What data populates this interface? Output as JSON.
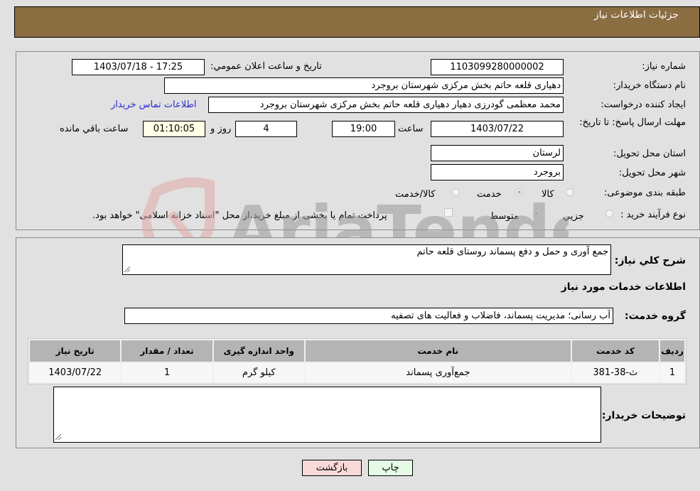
{
  "header": {
    "title": "جزئیات اطلاعات نیاز"
  },
  "form": {
    "need_number": {
      "label": "شماره نیاز:",
      "value": "1103099280000002"
    },
    "announce_datetime": {
      "label": "تاريخ و ساعت اعلان عمومي:",
      "value": "1403/07/18 - 17:25"
    },
    "buyer_org": {
      "label": "نام دستگاه خریدار:",
      "value": "دهیاری قلعه حاتم بخش مرکزی شهرستان بروجرد"
    },
    "requester": {
      "label": "ایجاد کننده درخواست:",
      "value": "محمد معظمی گودرزی دهیار دهیاری قلعه حاتم بخش مرکزی شهرستان بروجرد"
    },
    "buyer_contact_link": "اطلاعات تماس خريدار",
    "deadline": {
      "label": "مهلت ارسال پاسخ: تا تاریخ:",
      "date": "1403/07/22",
      "time_label": "ساعت",
      "time": "19:00",
      "days": "4",
      "days_label": "روز و",
      "remaining": "01:10:05",
      "remaining_label": "ساعت باقي مانده"
    },
    "province": {
      "label": "استان محل تحویل:",
      "value": "لرستان"
    },
    "city": {
      "label": "شهر محل تحویل:",
      "value": "بروجرد"
    },
    "category": {
      "label": "طبقه بندی موضوعی:",
      "options": [
        "کالا",
        "خدمت",
        "کالا/خدمت"
      ],
      "selected": "خدمت"
    },
    "purchase_type": {
      "label": "نوع فرآیند خرید :",
      "options": [
        "جزيي",
        "متوسط"
      ],
      "selected": "متوسط",
      "treasury_note": "پرداخت تمام یا بخشی از مبلغ خرید،از محل \"اسناد خزانه اسلامی\" خواهد بود."
    }
  },
  "details": {
    "summary_label": "شرح کلي نياز:",
    "summary_value": "جمع آوری و حمل و دفع پسماند روستای قلعه حاتم",
    "services_heading": "اطلاعات خدمات مورد نیاز",
    "service_group_label": "گروه خدمت:",
    "service_group_value": "آب رسانی؛ مدیریت پسماند، فاضلاب و فعالیت های تصفیه",
    "table": {
      "headers": [
        "ردیف",
        "کد خدمت",
        "نام خدمت",
        "واحد اندازه گیری",
        "تعداد / مقدار",
        "تاریخ نیاز"
      ],
      "rows": [
        [
          "1",
          "ث-38-381",
          "جمع‌آوری پسماند",
          "کیلو گرم",
          "1",
          "1403/07/22"
        ]
      ]
    },
    "buyer_notes_label": "توضیحات خریدار:",
    "buyer_notes_value": ""
  },
  "buttons": {
    "print": "چاپ",
    "back": "بازگشت"
  },
  "watermark": "AriaTender.neT"
}
